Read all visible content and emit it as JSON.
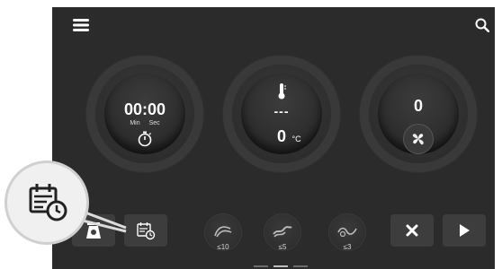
{
  "timer": {
    "value": "00:00",
    "min_label": "Min",
    "sec_label": "Sec"
  },
  "temperature": {
    "setpoint": "---",
    "value": "0",
    "unit": "°C"
  },
  "speed": {
    "value": "0"
  },
  "speed_modes": [
    {
      "label": "≤10"
    },
    {
      "label": "≤5"
    },
    {
      "label": "≤3"
    }
  ],
  "colors": {
    "background": "#2b2b2b",
    "button": "#3d3d3d",
    "text": "#ffffff"
  },
  "icons": {
    "menu": "menu-icon",
    "search": "search-icon",
    "stopwatch": "stopwatch-icon",
    "thermometer": "thermometer-icon",
    "fan": "fan-icon",
    "scale": "scale-icon",
    "schedule": "calendar-clock-icon",
    "stop": "close-icon",
    "play": "play-icon"
  }
}
